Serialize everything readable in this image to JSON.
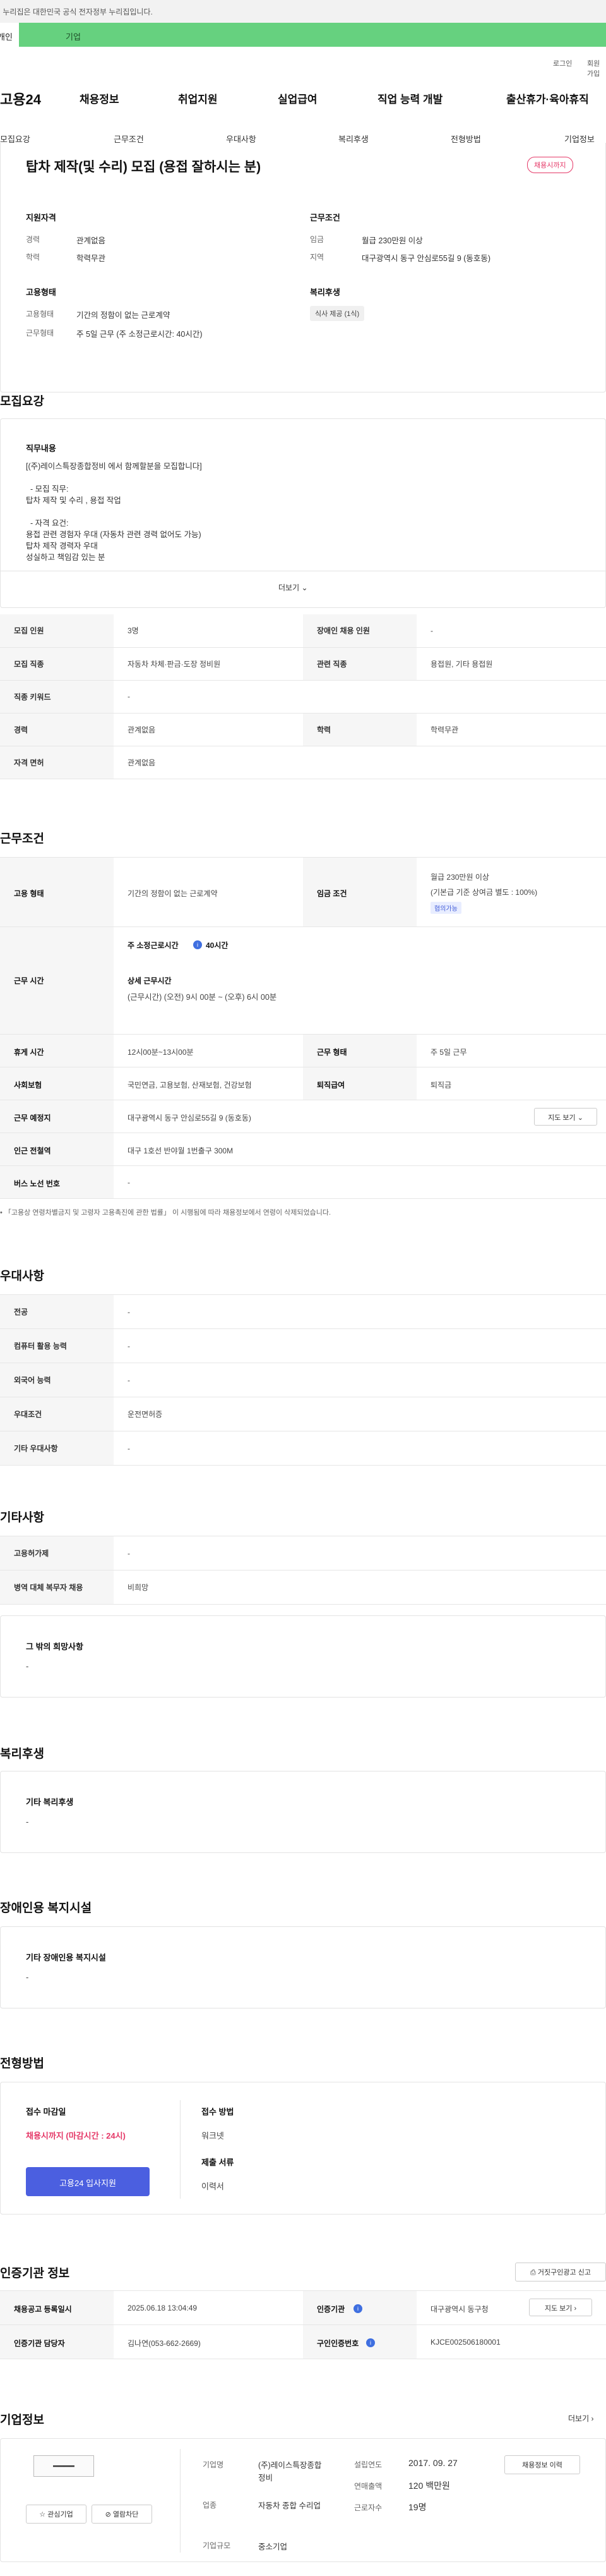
{
  "gov_bar": {
    "text": "이 누리집은 대한민국 공식 전자정부 누리집입니다."
  },
  "user_tabs": {
    "personal": "개인",
    "company": "기업"
  },
  "util": {
    "login": "로그인",
    "join": "회원가입"
  },
  "logo": "고용24",
  "gnb": [
    "채용정보",
    "취업지원",
    "실업급여",
    "직업 능력 개발",
    "출산휴가·육아휴직"
  ],
  "subnav": [
    "모집요강",
    "근무조건",
    "우대사항",
    "복리후생",
    "전형방법",
    "기업정보"
  ],
  "job": {
    "title": "탑차 제작(및 수리) 모집 (용접 잘하시는 분)",
    "deadline_badge": "채용시까지",
    "qualification": {
      "heading": "지원자격",
      "rows": [
        {
          "label": "경력",
          "value": "관계없음"
        },
        {
          "label": "학력",
          "value": "학력무관"
        }
      ]
    },
    "conditions": {
      "heading": "근무조건",
      "rows": [
        {
          "label": "임금",
          "value": "월급 230만원 이상"
        },
        {
          "label": "지역",
          "value": "대구광역시 동구 안심로55길 9 (동호동)"
        }
      ]
    },
    "employment": {
      "heading": "고용형태",
      "rows": [
        {
          "label": "고용형태",
          "value": "기간의 정함이 없는 근로계약"
        },
        {
          "label": "근무형태",
          "value": "주 5일 근무 (주 소정근로시간: 40시간)"
        }
      ]
    },
    "welfare": {
      "heading": "복리후생",
      "chip": "식사 제공 (1식)"
    }
  },
  "recruit": {
    "section_title": "모집요강",
    "duty_heading": "직무내용",
    "duty_lines": [
      "[(주)레이스특장종합정비 에서 함께할분을 모집합니다]",
      "",
      "  - 모집 직무:",
      "탑차 제작 및 수리 , 용접 작업",
      "",
      "  - 자격 요건:",
      "용접 관련 경험자 우대 (자동차 관련 경력 없어도 가능)",
      "탑차 제작 경력자 우대",
      "성실하고 책임감 있는 분"
    ],
    "more": "더보기",
    "table": [
      [
        "모집 인원",
        "3명",
        "장애인 채용 인원",
        "-"
      ],
      [
        "모집 직종",
        "자동차 차체·판금·도장 정비원",
        "관련 직종",
        "용접원, 기타 용접원"
      ],
      [
        "직종 키워드",
        "-",
        "",
        ""
      ],
      [
        "경력",
        "관계없음",
        "학력",
        "학력무관"
      ],
      [
        "자격 면허",
        "관계없음",
        "",
        ""
      ]
    ]
  },
  "work": {
    "section_title": "근무조건",
    "employment_type_label": "고용 형태",
    "employment_type": "기간의 정함이 없는 근로계약",
    "wage_label": "임금 조건",
    "wage_main": "월급 230만원 이상",
    "wage_sub": "(기본급 기준 상여금 별도 : 100%)",
    "wage_tag": "협의가능",
    "hours_label": "근무 시간",
    "weekly_hours_label": "주 소정근로시간",
    "weekly_hours_value": "40시간",
    "detail_hours_label": "상세 근무시간",
    "detail_hours_value": "(근무시간) (오전) 9시 00분 ~ (오후) 6시 00분",
    "rest_label": "휴게 시간",
    "rest_value": "12시00분~13시00분",
    "form_label": "근무 형태",
    "form_value": "주 5일 근무",
    "insurance_label": "사회보험",
    "insurance_value": "국민연금, 고용보험, 산재보험, 건강보험",
    "severance_label": "퇴직급여",
    "severance_value": "퇴직금",
    "location_label": "근무 예정지",
    "location_value": "대구광역시 동구 안심로55길 9 (동호동)",
    "map_btn": "지도 보기",
    "station_label": "인근 전철역",
    "station_value": "대구 1호선 반야월 1번출구 300M",
    "bus_label": "버스 노선 번호",
    "bus_value": "-",
    "note": "「고용상 연령차별금지 및 고령자 고용촉진에 관한 법률」 이 시행됨에 따라 채용정보에서 연령이 삭제되었습니다."
  },
  "prefer": {
    "section_title": "우대사항",
    "rows": [
      [
        "전공",
        "-"
      ],
      [
        "컴퓨터 활용 능력",
        "-"
      ],
      [
        "외국어 능력",
        "-"
      ],
      [
        "우대조건",
        "운전면허증"
      ],
      [
        "기타 우대사항",
        "-"
      ]
    ]
  },
  "etc": {
    "section_title": "기타사항",
    "rows": [
      [
        "고용허가제",
        "-"
      ],
      [
        "병역 대체 복무자 채용",
        "비희망"
      ]
    ],
    "hope_heading": "그 밖의 희망사항",
    "hope_value": "-"
  },
  "benefit": {
    "section_title": "복리후생",
    "heading": "기타 복리후생",
    "value": "-"
  },
  "disabled": {
    "section_title": "장애인용 복지시설",
    "heading": "기타 장애인용 복지시설",
    "value": "-"
  },
  "process": {
    "section_title": "전형방법",
    "deadline_heading": "접수 마감일",
    "deadline_value": "채용시까지 (마감시간 : 24시)",
    "apply_btn": "고용24 입사지원",
    "method_heading": "접수 방법",
    "method_value": "워크넷",
    "docs_heading": "제출 서류",
    "docs_value": "이력서"
  },
  "agency": {
    "section_title": "인증기관 정보",
    "report_btn": "거짓구인광고 신고",
    "rows": [
      [
        "채용공고 등록일시",
        "2025.06.18 13:04:49",
        "인증기관",
        "대구광역시 동구청"
      ],
      [
        "인증기관 담당자",
        "김나연(053-662-2669)",
        "구인인증번호",
        "KJCE002506180001"
      ]
    ],
    "map_btn": "지도 보기"
  },
  "company": {
    "section_title": "기업정보",
    "more": "더보기",
    "logo_text": "━━━━",
    "fav_btn": "관심기업",
    "block_btn": "열람차단",
    "name_label": "기업명",
    "name_value": "(주)레이스특장종합정비",
    "industry_label": "업종",
    "industry_value": "자동차 종합 수리업",
    "size_label": "기업규모",
    "size_value": "중소기업",
    "founded_label": "설립연도",
    "founded_value": "2017. 09. 27",
    "sales_label": "연매출액",
    "sales_value": "120 백만원",
    "employees_label": "근로자수",
    "employees_value": "19명",
    "history_btn": "채용정보 이력"
  }
}
